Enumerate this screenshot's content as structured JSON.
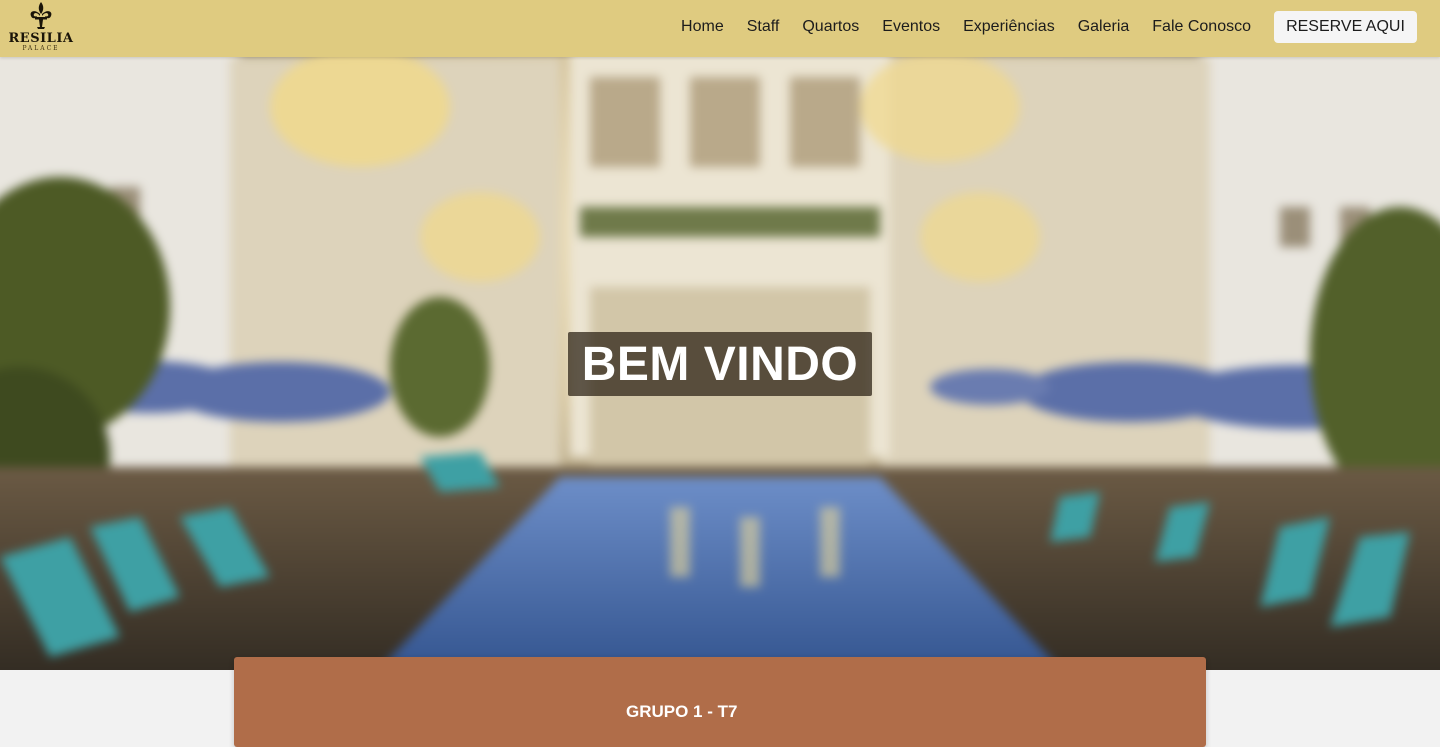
{
  "logo": {
    "name": "RESILIA",
    "sub": "PALACE",
    "icon": "fleur-de-lis-icon"
  },
  "nav": {
    "items": [
      "Home",
      "Staff",
      "Quartos",
      "Eventos",
      "Experiências",
      "Galeria",
      "Fale Conosco"
    ],
    "cta": "RESERVE AQUI"
  },
  "hero": {
    "title": "BEM VINDO"
  },
  "card": {
    "title": "GRUPO 1 - T7"
  },
  "colors": {
    "navbar": "#dfcb80",
    "card": "#b06d49",
    "page": "#f2f2f2"
  }
}
